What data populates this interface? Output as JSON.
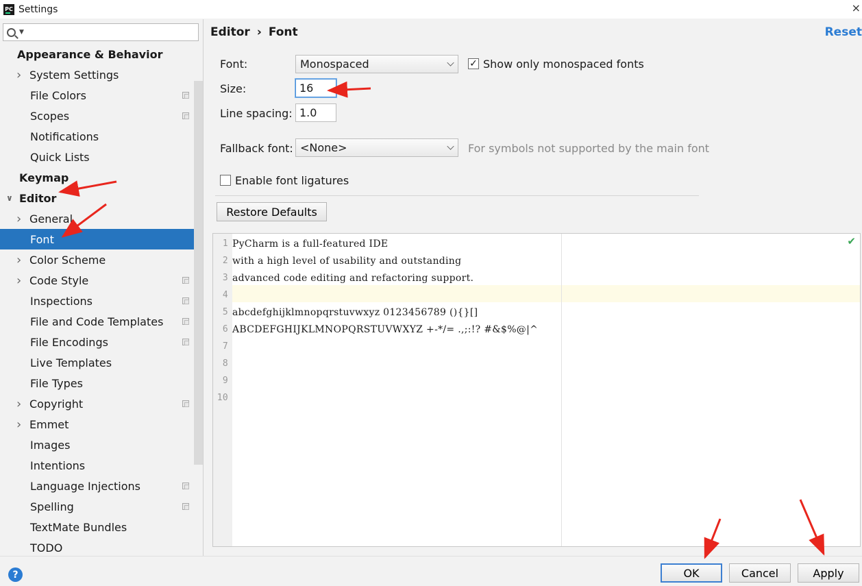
{
  "window": {
    "title": "Settings",
    "app_icon": "PC",
    "close": "×"
  },
  "sidebar": {
    "search_placeholder": "",
    "items": [
      {
        "label": "Appearance & Behavior",
        "level": 0,
        "section": true
      },
      {
        "label": "System Settings",
        "level": 1,
        "arrow": true
      },
      {
        "label": "File Colors",
        "level": 2,
        "project": true
      },
      {
        "label": "Scopes",
        "level": 2,
        "project": true
      },
      {
        "label": "Notifications",
        "level": 2
      },
      {
        "label": "Quick Lists",
        "level": 2
      },
      {
        "label": "Keymap",
        "level": 0,
        "section": true
      },
      {
        "label": "Editor",
        "level": 0,
        "section": true,
        "expanded": true
      },
      {
        "label": "General",
        "level": 1,
        "arrow": true
      },
      {
        "label": "Font",
        "level": 2,
        "selected": true
      },
      {
        "label": "Color Scheme",
        "level": 1,
        "arrow": true
      },
      {
        "label": "Code Style",
        "level": 1,
        "arrow": true,
        "project": true
      },
      {
        "label": "Inspections",
        "level": 2,
        "project": true
      },
      {
        "label": "File and Code Templates",
        "level": 2,
        "project": true
      },
      {
        "label": "File Encodings",
        "level": 2,
        "project": true
      },
      {
        "label": "Live Templates",
        "level": 2
      },
      {
        "label": "File Types",
        "level": 2
      },
      {
        "label": "Copyright",
        "level": 1,
        "arrow": true,
        "project": true
      },
      {
        "label": "Emmet",
        "level": 1,
        "arrow": true
      },
      {
        "label": "Images",
        "level": 2
      },
      {
        "label": "Intentions",
        "level": 2
      },
      {
        "label": "Language Injections",
        "level": 2,
        "project": true
      },
      {
        "label": "Spelling",
        "level": 2,
        "project": true
      },
      {
        "label": "TextMate Bundles",
        "level": 2
      },
      {
        "label": "TODO",
        "level": 2
      }
    ]
  },
  "main": {
    "breadcrumb": [
      "Editor",
      "›",
      "Font"
    ],
    "reset": "Reset",
    "font_label": "Font:",
    "font_value": "Monospaced",
    "show_mono_label": "Show only monospaced fonts",
    "show_mono_checked": "✓",
    "size_label": "Size:",
    "size_value": "16",
    "spacing_label": "Line spacing:",
    "spacing_value": "1.0",
    "fallback_label": "Fallback font:",
    "fallback_value": "<None>",
    "fallback_hint": "For symbols not supported by the main font",
    "ligatures_label": "Enable font ligatures",
    "restore_defaults": "Restore Defaults"
  },
  "preview": {
    "lines": [
      {
        "n": "1",
        "text": "PyCharm is a full-featured IDE"
      },
      {
        "n": "2",
        "text": "with a high level of usability and outstanding"
      },
      {
        "n": "3",
        "text": "advanced code editing and refactoring support."
      },
      {
        "n": "4",
        "text": ""
      },
      {
        "n": "5",
        "text": "abcdefghijklmnopqrstuvwxyz 0123456789 (){}[]"
      },
      {
        "n": "6",
        "text": "ABCDEFGHIJKLMNOPQRSTUVWXYZ +-*/= .,;:!? #&$%@|^"
      },
      {
        "n": "7",
        "text": ""
      },
      {
        "n": "8",
        "text": ""
      },
      {
        "n": "9",
        "text": ""
      },
      {
        "n": "10",
        "text": ""
      }
    ],
    "check": "✔"
  },
  "footer": {
    "help": "?",
    "ok": "OK",
    "cancel": "Cancel",
    "apply": "Apply"
  },
  "colors": {
    "accent": "#2675bf",
    "link": "#2b7cd3",
    "annotation": "#e8261d",
    "current_line": "#fefbe6"
  }
}
